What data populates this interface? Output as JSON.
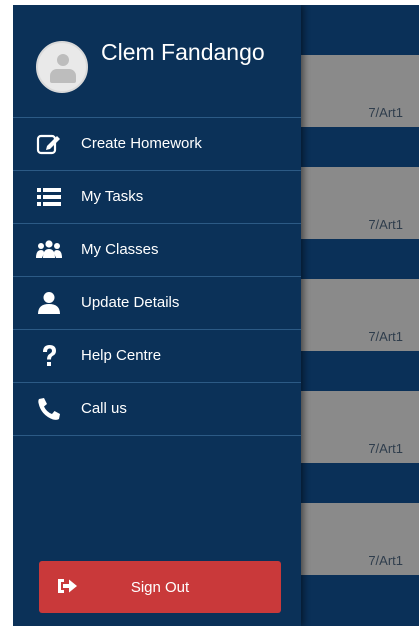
{
  "user": {
    "name": "Clem Fandango"
  },
  "menu": [
    {
      "label": "Create Homework",
      "icon": "edit-icon"
    },
    {
      "label": "My Tasks",
      "icon": "list-icon"
    },
    {
      "label": "My Classes",
      "icon": "group-icon"
    },
    {
      "label": "Update Details",
      "icon": "user-icon"
    },
    {
      "label": "Help Centre",
      "icon": "question-icon"
    },
    {
      "label": "Call us",
      "icon": "phone-icon"
    }
  ],
  "signout": {
    "label": "Sign Out",
    "icon": "sign-out-icon",
    "color": "#c9393a"
  },
  "background_cards": [
    {
      "label": "7/Art1"
    },
    {
      "label": "7/Art1"
    },
    {
      "label": "7/Art1"
    },
    {
      "label": "7/Art1"
    },
    {
      "label": "7/Art1"
    }
  ],
  "colors": {
    "drawer": "#0b3158",
    "divider": "#2c5a85",
    "card": "#8a8a8a"
  }
}
